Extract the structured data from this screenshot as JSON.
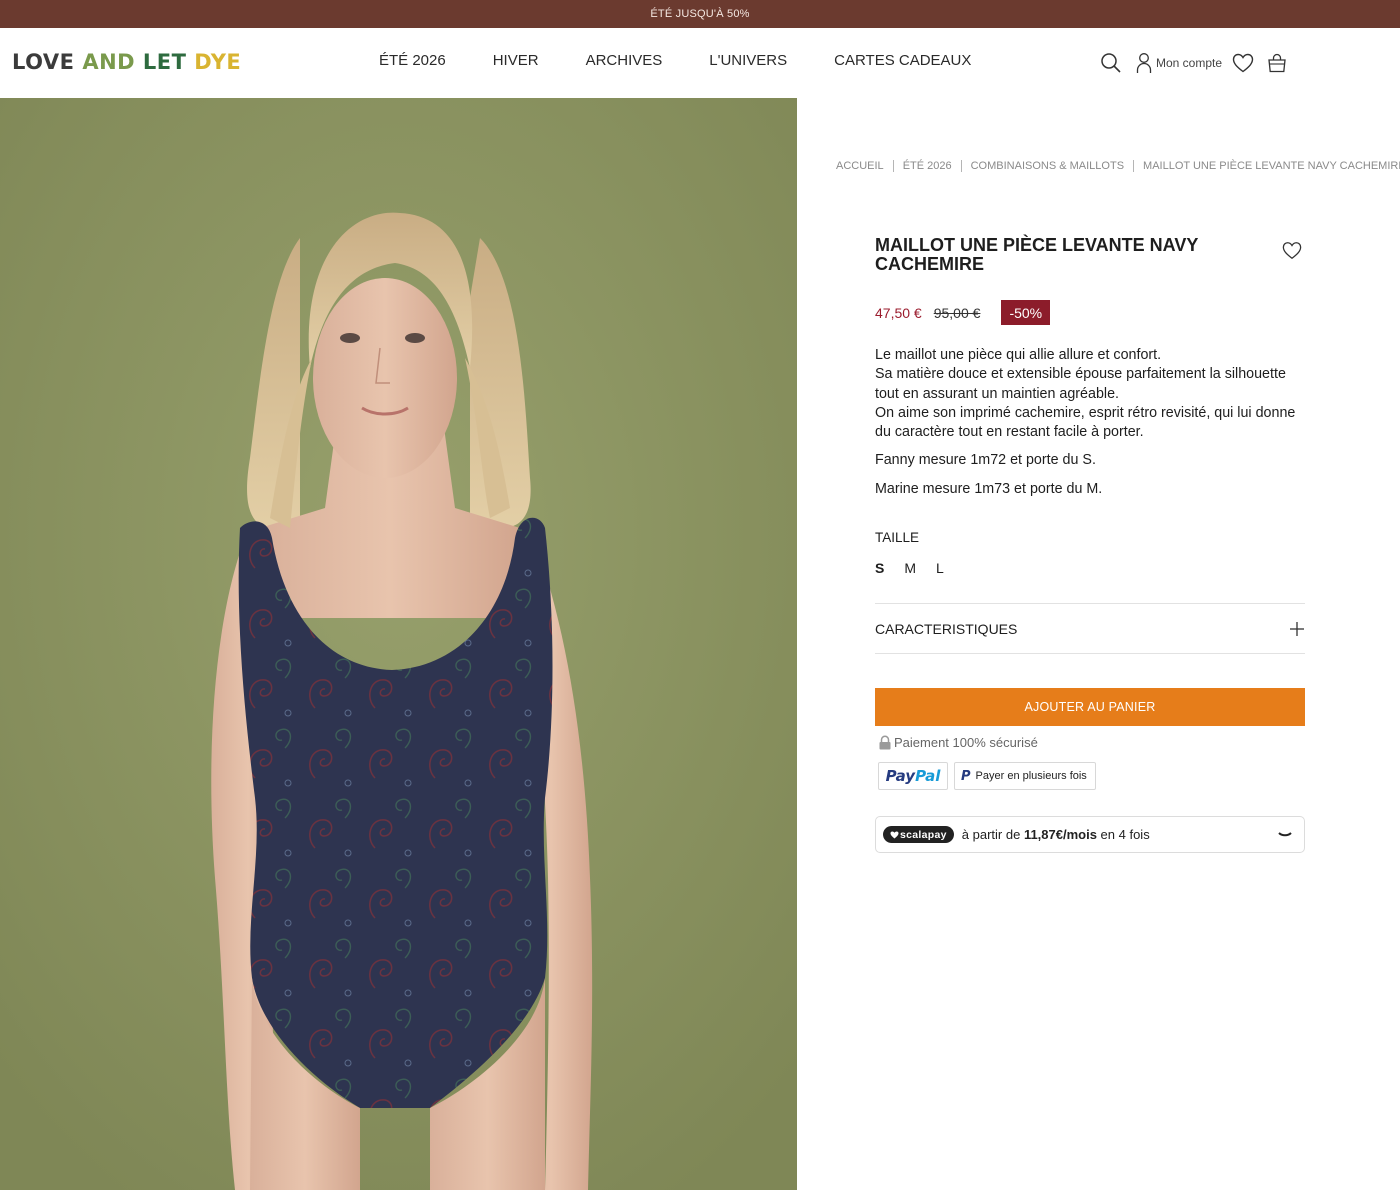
{
  "promo": {
    "text": "ÉTÉ JUSQU'À 50%"
  },
  "header": {
    "logo": {
      "words": [
        {
          "text": "LOVE",
          "color": "#3b3b3b"
        },
        {
          "text": "AND",
          "color": "#7a9a4c"
        },
        {
          "text": "LET",
          "color": "#2e6b3f"
        },
        {
          "text": "DYE",
          "color": "#d9b431"
        }
      ]
    },
    "nav": [
      "ÉTÉ 2026",
      "HIVER",
      "ARCHIVES",
      "L'UNIVERS",
      "CARTES CADEAUX"
    ],
    "account_label": "Mon compte",
    "icons": [
      "search-icon",
      "user-icon",
      "heart-icon",
      "bag-icon"
    ]
  },
  "breadcrumb": [
    "ACCUEIL",
    "ÉTÉ 2026",
    "COMBINAISONS & MAILLOTS",
    "MAILLOT UNE PIÈCE LEVANTE NAVY CACHEMIRE"
  ],
  "product": {
    "title": "MAILLOT UNE PIÈCE LEVANTE NAVY CACHEMIRE",
    "price_sale": "47,50 €",
    "price_old": "95,00 €",
    "discount": "-50%",
    "description": [
      "Le maillot une pièce qui allie allure et confort.\nSa matière douce et extensible épouse parfaitement la silhouette tout en assurant un maintien agréable.\nOn aime son imprimé cachemire, esprit rétro revisité, qui lui donne du caractère tout en restant facile à porter.",
      "Fanny mesure 1m72 et porte du S.",
      "Marine mesure 1m73 et porte du M."
    ],
    "size_label": "TAILLE",
    "sizes": [
      "S",
      "M",
      "L"
    ],
    "selected_size": "S",
    "characteristics_label": "CARACTERISTIQUES",
    "add_to_cart": "AJOUTER AU PANIER",
    "secure_payment": "Paiement 100% sécurisé",
    "paypal": {
      "pay": "Pay",
      "pal": "Pal",
      "later": "Payer en plusieurs fois"
    },
    "scalapay": {
      "badge": "scalapay",
      "prefix": "à partir de ",
      "amount": "11,87€/mois",
      "suffix": " en 4 fois"
    }
  },
  "colors": {
    "promo_bg": "#6b3a2f",
    "sale_price": "#9b1c2e",
    "discount_bg": "#8c1c2a",
    "cta": "#e67d1a",
    "photo_bg": "#8d9562",
    "swimsuit": "#2e3450"
  }
}
